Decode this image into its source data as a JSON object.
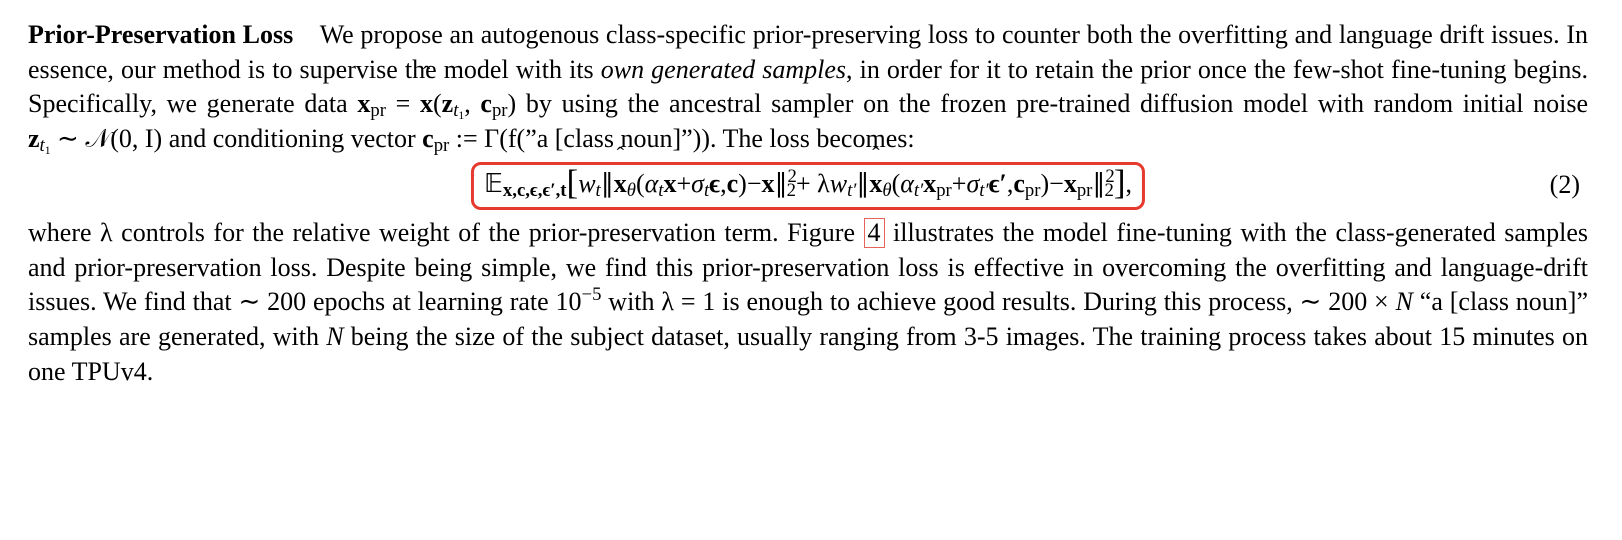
{
  "heading": "Prior-Preservation Loss",
  "para1_seg1": "We propose an autogenous class-specific prior-preserving loss to counter both the overfitting and language drift issues. In essence, our method is to supervise the model with its ",
  "para1_em": "own generated samples",
  "para1_seg2": ", in order for it to retain the prior once the few-shot fine-tuning begins. Specifically, we generate data ",
  "para1_math1_a": "x",
  "para1_math1_b": "pr",
  "para1_math1_eq": " = ",
  "para1_math1_c": "x",
  "para1_math1_d": "(",
  "para1_math1_e": "z",
  "para1_math1_f": "t",
  "para1_math1_f2": "1",
  "para1_math1_g": ", ",
  "para1_math1_h": "c",
  "para1_math1_i": "pr",
  "para1_math1_j": ")",
  "para1_seg3": " by using the ancestral sampler on the frozen pre-trained diffusion model with random initial noise ",
  "para1_math2_a": "z",
  "para1_math2_b": "t",
  "para1_math2_b2": "1",
  "para1_math2_c": " ∼ 𝒩(0, I)",
  "para1_seg4": " and conditioning vector ",
  "para1_math3_a": "c",
  "para1_math3_b": "pr",
  "para1_math3_c": " := Γ(f(”a [class noun]”))",
  "para1_seg5": ". The loss becomes:",
  "eq": {
    "E": "𝔼",
    "Esub": "x,c,ϵ,ϵ′,t",
    "lb": "[",
    "w": "w",
    "t": "t",
    "bar1": "∥",
    "xhat": "x",
    "theta": "θ",
    "lp": "(",
    "alpha": "α",
    "x": "x",
    "plus": " + ",
    "sigma": "σ",
    "eps": "ϵ",
    "comma": ", ",
    "c": "c",
    "rp": ")",
    "minus": " − ",
    "bar2": "∥",
    "sq": "2",
    "two": "2",
    "lam": " + λ",
    "tp": "t′",
    "pr": "pr",
    "epsp": "ϵ′",
    "rb": "]",
    "tail": " ,"
  },
  "eq_num": "(2)",
  "para2_seg1": "where λ controls for the relative weight of the prior-preservation term. Figure ",
  "para2_fig": "4",
  "para2_seg2": " illustrates the model fine-tuning with the class-generated samples and prior-preservation loss. Despite being simple, we find this prior-preservation loss is effective in overcoming the overfitting and language-drift issues. We find that ∼ 200 epochs at learning rate 10",
  "para2_exp": "−5",
  "para2_seg3": " with λ = 1 is enough to achieve good results. During this process, ∼ 200 × ",
  "para2_N": "N",
  "para2_seg4": " “a [class noun]” samples are generated, with ",
  "para2_N2": "N",
  "para2_seg5": " being the size of the subject dataset, usually ranging from 3-5 images. The training process takes about 15 minutes on one TPUv4."
}
